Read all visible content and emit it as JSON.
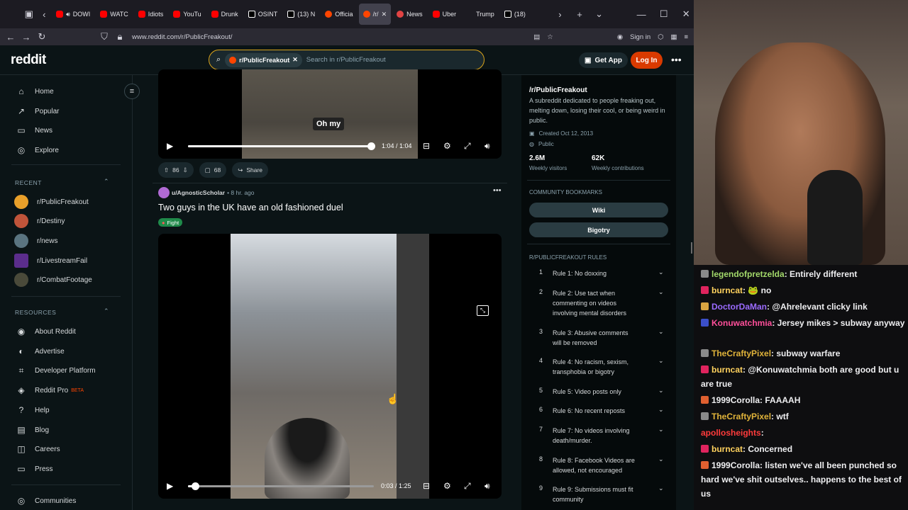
{
  "browser": {
    "tabs": [
      {
        "label": "DOWI",
        "icon": "youtube-favicon",
        "audio": true
      },
      {
        "label": "WATC",
        "icon": "youtube-favicon"
      },
      {
        "label": "Idiots",
        "icon": "youtube-favicon"
      },
      {
        "label": "YouTu",
        "icon": "youtube-favicon"
      },
      {
        "label": "Drunk",
        "icon": "youtube-favicon"
      },
      {
        "label": "OSINT",
        "icon": "x-favicon"
      },
      {
        "label": "(13) N",
        "icon": "x-favicon"
      },
      {
        "label": "Officia",
        "icon": "reddit-favicon"
      },
      {
        "label": "/r/",
        "icon": "reddit-favicon",
        "active": true
      },
      {
        "label": "News",
        "icon": "news-favicon"
      },
      {
        "label": "Uber",
        "icon": "youtube-favicon"
      },
      {
        "label": "Trump",
        "icon": "none"
      },
      {
        "label": "(18)",
        "icon": "x-favicon"
      }
    ],
    "url": "www.reddit.com/r/PublicFreakout/",
    "sign_in": "Sign in"
  },
  "header": {
    "logo": "reddit",
    "search_chip": "r/PublicFreakout",
    "search_placeholder": "Search in r/PublicFreakout",
    "get_app": "Get App",
    "login": "Log In"
  },
  "sidebar": {
    "nav": [
      "Home",
      "Popular",
      "News",
      "Explore"
    ],
    "recent_title": "RECENT",
    "recent": [
      "r/PublicFreakout",
      "r/Destiny",
      "r/news",
      "r/LivestreamFail",
      "r/CombatFootage"
    ],
    "resources_title": "RESOURCES",
    "resources": [
      "About Reddit",
      "Advertise",
      "Developer Platform",
      "Reddit Pro",
      "Help",
      "Blog",
      "Careers",
      "Press"
    ],
    "beta": "BETA",
    "communities": "Communities"
  },
  "post1": {
    "caption": "Oh my",
    "time": "1:04 / 1:04",
    "progress": 1.0,
    "upvotes": "86",
    "comments": "68",
    "share": "Share"
  },
  "post2": {
    "author": "u/AgnosticScholar",
    "age": "• 8 hr. ago",
    "title": "Two guys in the UK have an old fashioned duel",
    "flair": "Fight",
    "time": "0:03 / 1:25",
    "progress": 0.04
  },
  "rightpanel": {
    "name": "/r/PublicFreakout",
    "description": "A subreddit dedicated to people freaking out, melting down, losing their cool, or being weird in public.",
    "created": "Created Oct 12, 2013",
    "visibility": "Public",
    "stat1_value": "2.6M",
    "stat1_label": "Weekly visitors",
    "stat2_value": "62K",
    "stat2_label": "Weekly contributions",
    "bookmarks_title": "COMMUNITY BOOKMARKS",
    "bookmarks": [
      "Wiki",
      "Bigotry"
    ],
    "rules_title": "R/PUBLICFREAKOUT RULES",
    "rules": [
      {
        "num": "1",
        "text": "Rule 1: No doxxing"
      },
      {
        "num": "2",
        "text": "Rule 2: Use tact when commenting on videos involving mental disorders"
      },
      {
        "num": "3",
        "text": "Rule 3: Abusive comments will be removed"
      },
      {
        "num": "4",
        "text": "Rule 4: No racism, sexism, transphobia or bigotry"
      },
      {
        "num": "5",
        "text": "Rule 5: Video posts only"
      },
      {
        "num": "6",
        "text": "Rule 6: No recent reposts"
      },
      {
        "num": "7",
        "text": "Rule 7: No videos involving death/murder."
      },
      {
        "num": "8",
        "text": "Rule 8: Facebook Videos are allowed, not encouraged"
      },
      {
        "num": "9",
        "text": "Rule 9: Submissions must fit community"
      }
    ]
  },
  "chat": [
    {
      "user": "legendofpretzelda",
      "color": "#a3d96a",
      "text": ": Entirely different",
      "badge": "#8a8a8a"
    },
    {
      "user": "burncat",
      "color": "#ffd25e",
      "text": ": 🐸 no",
      "badge": "#e0245e"
    },
    {
      "user": "DoctorDaMan",
      "color": "#9b6bff",
      "text": ": @Ahrelevant clicky link",
      "badge": "#d9a441"
    },
    {
      "user": "Konuwatchmia",
      "color": "#ff4f9a",
      "text": ": Jersey mikes > subway anyway",
      "badge": "#3b4fc9"
    },
    {
      "user": "TheCraftyPixel",
      "color": "#e0b33a",
      "text": ": subway warfare",
      "badge": "#8a8a8a"
    },
    {
      "user": "burncat",
      "color": "#ffd25e",
      "text": ": @Konuwatchmia both are good but u are true",
      "badge": "#e0245e"
    },
    {
      "user": "1999Corolla",
      "color": "#efeff1",
      "text": ": FAAAAH",
      "badge": "#e06030"
    },
    {
      "user": "TheCraftyPixel",
      "color": "#e0b33a",
      "text": ": wtf",
      "badge": "#8a8a8a"
    },
    {
      "user": "apollosheights",
      "color": "#ff3b3b",
      "text": ":",
      "badge": "none"
    },
    {
      "user": "burncat",
      "color": "#ffd25e",
      "text": ": Concerned",
      "badge": "#e0245e"
    },
    {
      "user": "1999Corolla",
      "color": "#efeff1",
      "text": ": listen we've all been punched so hard we've shit outselves.. happens to the best of us",
      "badge": "#e06030"
    }
  ]
}
